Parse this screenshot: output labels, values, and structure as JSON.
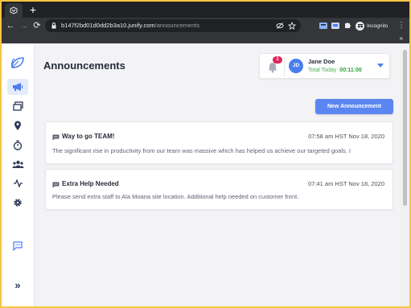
{
  "browser": {
    "url_host": "b147f2bd01d0dd2b3a10.junify.com",
    "url_path": "/announcements",
    "incognito_label": "Incognito",
    "icons": [
      "favicon-icon",
      "new-tab-icon",
      "back-icon",
      "forward-icon",
      "reload-icon",
      "lock-icon",
      "eye-off-icon",
      "star-icon",
      "extension-icon",
      "puzzle-icon",
      "incognito-icon",
      "menu-icon",
      "more-bookmarks-icon"
    ]
  },
  "sidebar": {
    "items": [
      {
        "name": "logo",
        "icon": "leaf-icon"
      },
      {
        "name": "announcements",
        "icon": "megaphone-icon",
        "active": true
      },
      {
        "name": "windows",
        "icon": "windows-icon"
      },
      {
        "name": "locations",
        "icon": "map-pin-icon"
      },
      {
        "name": "timer",
        "icon": "stopwatch-icon"
      },
      {
        "name": "team",
        "icon": "users-icon"
      },
      {
        "name": "activity",
        "icon": "activity-icon"
      },
      {
        "name": "settings",
        "icon": "gear-icon"
      },
      {
        "name": "chat",
        "icon": "chat-icon"
      }
    ],
    "collapse_label": "»"
  },
  "header": {
    "title": "Announcements"
  },
  "user": {
    "notification_count": "1",
    "initials": "JD",
    "name": "Jane Doe",
    "total_label": "Total Today",
    "total_time": "00:11:00"
  },
  "actions": {
    "new_label": "New Announcement"
  },
  "announcements": [
    {
      "title": "Way to go TEAM!",
      "time": "07:58 am HST Nov 18, 2020",
      "body": "The significant rise in productivity from our team was massive which has helped us achieve our targeted goals. I"
    },
    {
      "title": "Extra Help Needed",
      "time": "07:41 am HST Nov 18, 2020",
      "body": "Please send extra staff to Ala Moana site location. Additional help needed on customer front."
    }
  ],
  "colors": {
    "accent": "#5b86f2",
    "badge": "#e0245e",
    "time_green": "#2e9c3d",
    "window_border": "#f5c542"
  }
}
